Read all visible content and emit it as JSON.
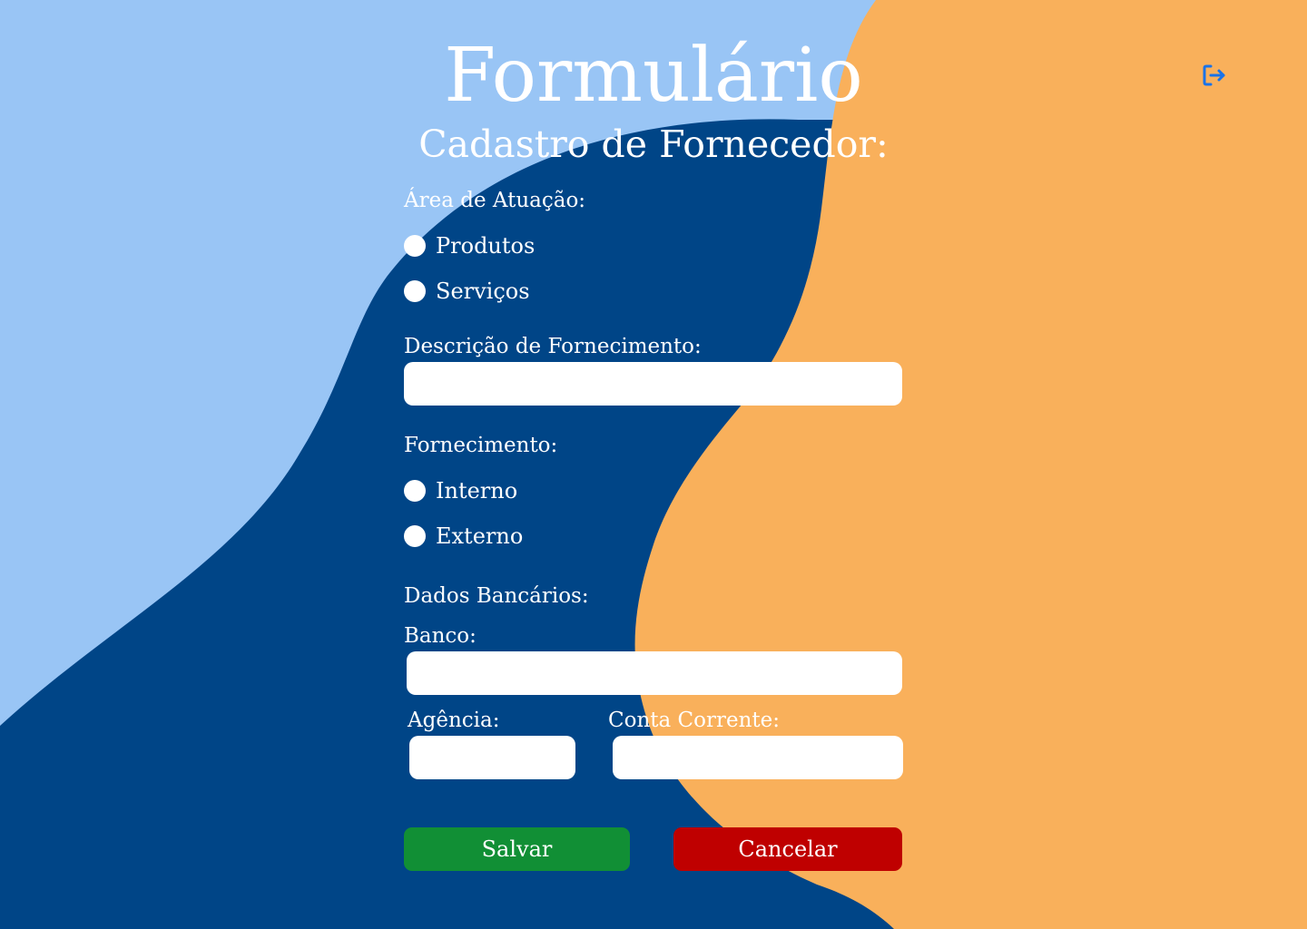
{
  "header": {
    "title": "Formulário",
    "subtitle": "Cadastro de Fornecedor:"
  },
  "logout": {
    "icon": "logout-icon",
    "color": "#1a73e8"
  },
  "form": {
    "area_label": "Área de Atuação:",
    "area_options": [
      "Produtos",
      "Serviços"
    ],
    "descricao_label": "Descrição de Fornecimento:",
    "descricao_value": "",
    "fornecimento_label": "Fornecimento:",
    "fornecimento_options": [
      "Interno",
      "Externo"
    ],
    "dados_bancarios_label": "Dados Bancários:",
    "banco_label": "Banco:",
    "banco_value": "",
    "agencia_label": "Agência:",
    "agencia_value": "",
    "conta_label": "Conta Corrente:",
    "conta_value": ""
  },
  "buttons": {
    "save_label": "Salvar",
    "save_color": "#118f35",
    "cancel_label": "Cancelar",
    "cancel_color": "#bf0000"
  },
  "colors": {
    "light_blue": "#99c5f5",
    "dark_blue": "#004587",
    "orange": "#f9b05b"
  }
}
